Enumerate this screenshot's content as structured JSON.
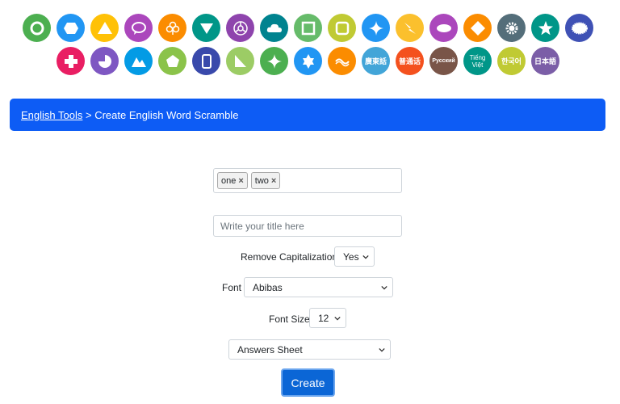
{
  "colors": {
    "banner": "#0d5cf5",
    "create_button": "#0b66d6"
  },
  "icon_rows": [
    [
      {
        "name": "circle-shape-icon",
        "color": "#4caf50"
      },
      {
        "name": "hexagon-shape-icon",
        "color": "#2196f3"
      },
      {
        "name": "triangle-shape-icon",
        "color": "#ffc107"
      },
      {
        "name": "speech-bubble-icon",
        "color": "#ab47bc"
      },
      {
        "name": "club-icon",
        "color": "#fb8c00"
      },
      {
        "name": "down-triangle-icon",
        "color": "#009688"
      },
      {
        "name": "steering-wheel-icon",
        "color": "#8e44ad"
      },
      {
        "name": "cloud-icon",
        "color": "#00838f"
      },
      {
        "name": "square-shape-icon",
        "color": "#66bb6a"
      },
      {
        "name": "rounded-square-icon",
        "color": "#c0ca33"
      },
      {
        "name": "four-point-star-icon",
        "color": "#2196f3"
      },
      {
        "name": "lightning-icon",
        "color": "#fbc02d"
      },
      {
        "name": "ellipse-icon",
        "color": "#ab47bc"
      },
      {
        "name": "diamond-icon",
        "color": "#fb8c00"
      },
      {
        "name": "gear-icon",
        "color": "#546e7a"
      },
      {
        "name": "star-icon",
        "color": "#009688"
      },
      {
        "name": "badge-icon",
        "color": "#3f51b5"
      }
    ],
    [
      {
        "name": "plus-cross-icon",
        "color": "#e91e63"
      },
      {
        "name": "pie-shape-icon",
        "color": "#7e57c2"
      },
      {
        "name": "mountain-icon",
        "color": "#039be5"
      },
      {
        "name": "pentagon-icon",
        "color": "#8bc34a"
      },
      {
        "name": "tablet-icon",
        "color": "#3949ab"
      },
      {
        "name": "right-triangle-icon",
        "color": "#9ccc65"
      },
      {
        "name": "sparkle-icon",
        "color": "#4caf50"
      },
      {
        "name": "six-point-star-icon",
        "color": "#2196f3"
      },
      {
        "name": "wave-icon",
        "color": "#fb8c00"
      }
    ]
  ],
  "languages": [
    {
      "text": "廣東話",
      "color": "#42a5d8",
      "style": "lang-text"
    },
    {
      "text": "普通话",
      "color": "#f4511e",
      "style": "lang-text"
    },
    {
      "text": "Русский",
      "color": "#795548",
      "style": "lang-small"
    },
    {
      "text": "Tiếng\nViệt",
      "color": "#009688",
      "style": "lang-two"
    },
    {
      "text": "한국어",
      "color": "#c0ca33",
      "style": "lang-text"
    },
    {
      "text": "日本語",
      "color": "#7b5ea7",
      "style": "lang-text"
    }
  ],
  "breadcrumb": {
    "link": "English Tools",
    "separator": " > ",
    "current": "Create English Word Scramble"
  },
  "tags": [
    {
      "label": "one",
      "remove": "×"
    },
    {
      "label": "two",
      "remove": "×"
    }
  ],
  "title_input": {
    "value": "",
    "placeholder": "Write your title here"
  },
  "remove_cap": {
    "label": "Remove Capitalization",
    "value": "Yes"
  },
  "font": {
    "label": "Font",
    "value": "Abibas"
  },
  "font_size": {
    "label": "Font Size",
    "value": "12"
  },
  "sheet": {
    "value": "Answers Sheet"
  },
  "create_label": "Create"
}
